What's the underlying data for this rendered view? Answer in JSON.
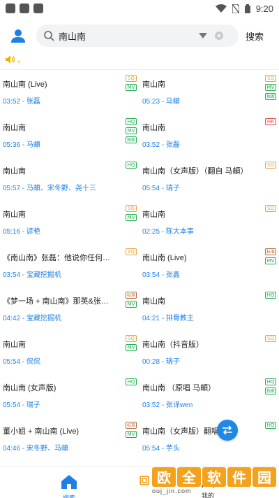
{
  "status": {
    "time": "9:20"
  },
  "header": {
    "search_placeholder": "",
    "search_value": "南山南",
    "search_button": "搜索"
  },
  "notice": {
    "text": "。"
  },
  "results": [
    [
      {
        "title": "南山南 (Live)",
        "duration": "03:52",
        "artist": "张磊",
        "badges": [
          "SQ",
          "MV"
        ]
      },
      {
        "title": "南山南",
        "duration": "05:23",
        "artist": "马頔",
        "badges": [
          "SQ",
          "MV",
          "独家"
        ]
      }
    ],
    [
      {
        "title": "南山南",
        "duration": "05:36",
        "artist": "马頔",
        "badges": [
          "HQ",
          "MV",
          "独家"
        ]
      },
      {
        "title": "南山南",
        "duration": "03:52",
        "artist": "张磊",
        "badges": [
          "HR"
        ]
      }
    ],
    [
      {
        "title": "南山南",
        "duration": "05:57",
        "artist": "马頔、宋冬野、尧十三",
        "badges": [
          "HQ"
        ]
      },
      {
        "title": "南山南（女声版）（翻自 马頔）",
        "duration": "05:54",
        "artist": "瑞子",
        "badges": [
          "SQ"
        ]
      }
    ],
    [
      {
        "title": "南山南",
        "duration": "05:16",
        "artist": "谚艳",
        "badges": [
          "SQ",
          "MV"
        ]
      },
      {
        "title": "南山南",
        "duration": "02:25",
        "artist": "陈大本事",
        "badges": [
          "SQ"
        ]
      }
    ],
    [
      {
        "title": "《南山南》张磊：他说你任何为…",
        "duration": "03:54",
        "artist": "宝藏挖掘机",
        "badges": [
          "SQ"
        ]
      },
      {
        "title": "南山南 (Live)",
        "duration": "03:54",
        "artist": "张鑫",
        "badges": [
          "标准",
          "MV"
        ]
      }
    ],
    [
      {
        "title": "《梦一场 + 南山南》那英&张磊…",
        "duration": "04:42",
        "artist": "宝藏挖掘机",
        "badges": [
          "标准",
          "MV"
        ]
      },
      {
        "title": "南山南",
        "duration": "04:21",
        "artist": "排骨教主",
        "badges": [
          "HQ"
        ]
      }
    ],
    [
      {
        "title": "南山南",
        "duration": "05:54",
        "artist": "侃侃",
        "badges": [
          "SQ",
          "MV"
        ]
      },
      {
        "title": "南山南（抖音版）",
        "duration": "00:28",
        "artist": "瑞子",
        "badges": [
          "SQ"
        ]
      }
    ],
    [
      {
        "title": "南山南 (女声版)",
        "duration": "05:54",
        "artist": "瑞子",
        "badges": [
          "HQ"
        ]
      },
      {
        "title": "南山南 （原唱 马頔）",
        "duration": "03:52",
        "artist": "张译wen",
        "badges": [
          "HQ",
          "独家"
        ]
      }
    ],
    [
      {
        "title": "董小姐 + 南山南 (Live)",
        "duration": "04:46",
        "artist": "宋冬野、马頔",
        "badges": [
          "标准",
          "MV"
        ]
      },
      {
        "title": "南山南（女声版）翻唱",
        "duration": "05:54",
        "artist": "芋头",
        "badges": [
          "HQ"
        ]
      }
    ]
  ],
  "nav": {
    "search_label": "搜索",
    "mine_label": "我的"
  },
  "watermark": {
    "cn": [
      "欧",
      "全",
      "软",
      "件",
      "园"
    ],
    "url": "ouj_jin.com"
  },
  "colors": {
    "accent": "#1e80e6",
    "sq": "#e8a33d",
    "hq": "#1fae4f",
    "hr": "#e24b4b"
  }
}
